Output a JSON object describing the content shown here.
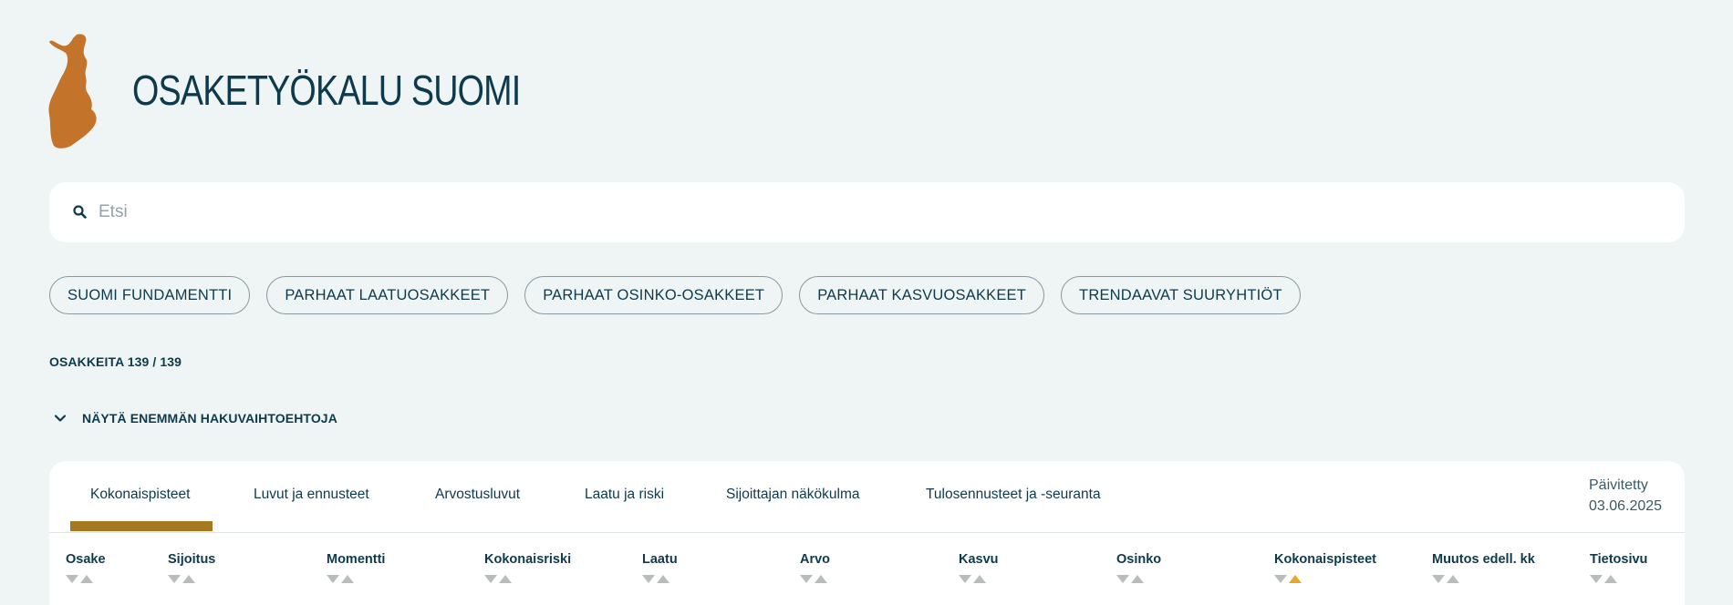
{
  "header": {
    "title": "OSAKETYÖKALU SUOMI"
  },
  "search": {
    "placeholder": "Etsi",
    "value": ""
  },
  "chips": [
    "SUOMI FUNDAMENTTI",
    "PARHAAT LAATUOSAKKEET",
    "PARHAAT OSINKO-OSAKKEET",
    "PARHAAT KASVUOSAKKEET",
    "TRENDAAVAT SUURYHTIÖT"
  ],
  "stock_count": "OSAKKEITA 139 / 139",
  "more_options": "NÄYTÄ ENEMMÄN HAKUVAIHTOEHTOJA",
  "tabs": [
    "Kokonaispisteet",
    "Luvut ja ennusteet",
    "Arvostusluvut",
    "Laatu ja riski",
    "Sijoittajan näkökulma",
    "Tulosennusteet ja -seuranta"
  ],
  "active_tab": "Kokonaispisteet",
  "updated": {
    "label": "Päivitetty",
    "date": "03.06.2025"
  },
  "columns": [
    "Osake",
    "Sijoitus",
    "Momentti",
    "Kokonaisriski",
    "Laatu",
    "Arvo",
    "Kasvu",
    "Osinko",
    "Kokonaispisteet",
    "Muutos edell. kk",
    "Tietosivu"
  ],
  "active_sort_column": "Kokonaispisteet",
  "active_sort_direction": "asc",
  "colors": {
    "background": "#eff5f4",
    "brand_orange": "#c4732b",
    "text_dark": "#0d3a4d",
    "tab_indicator": "#a6791f",
    "sort_active": "#e9a52a",
    "sort_inactive": "#b7bcbf"
  }
}
